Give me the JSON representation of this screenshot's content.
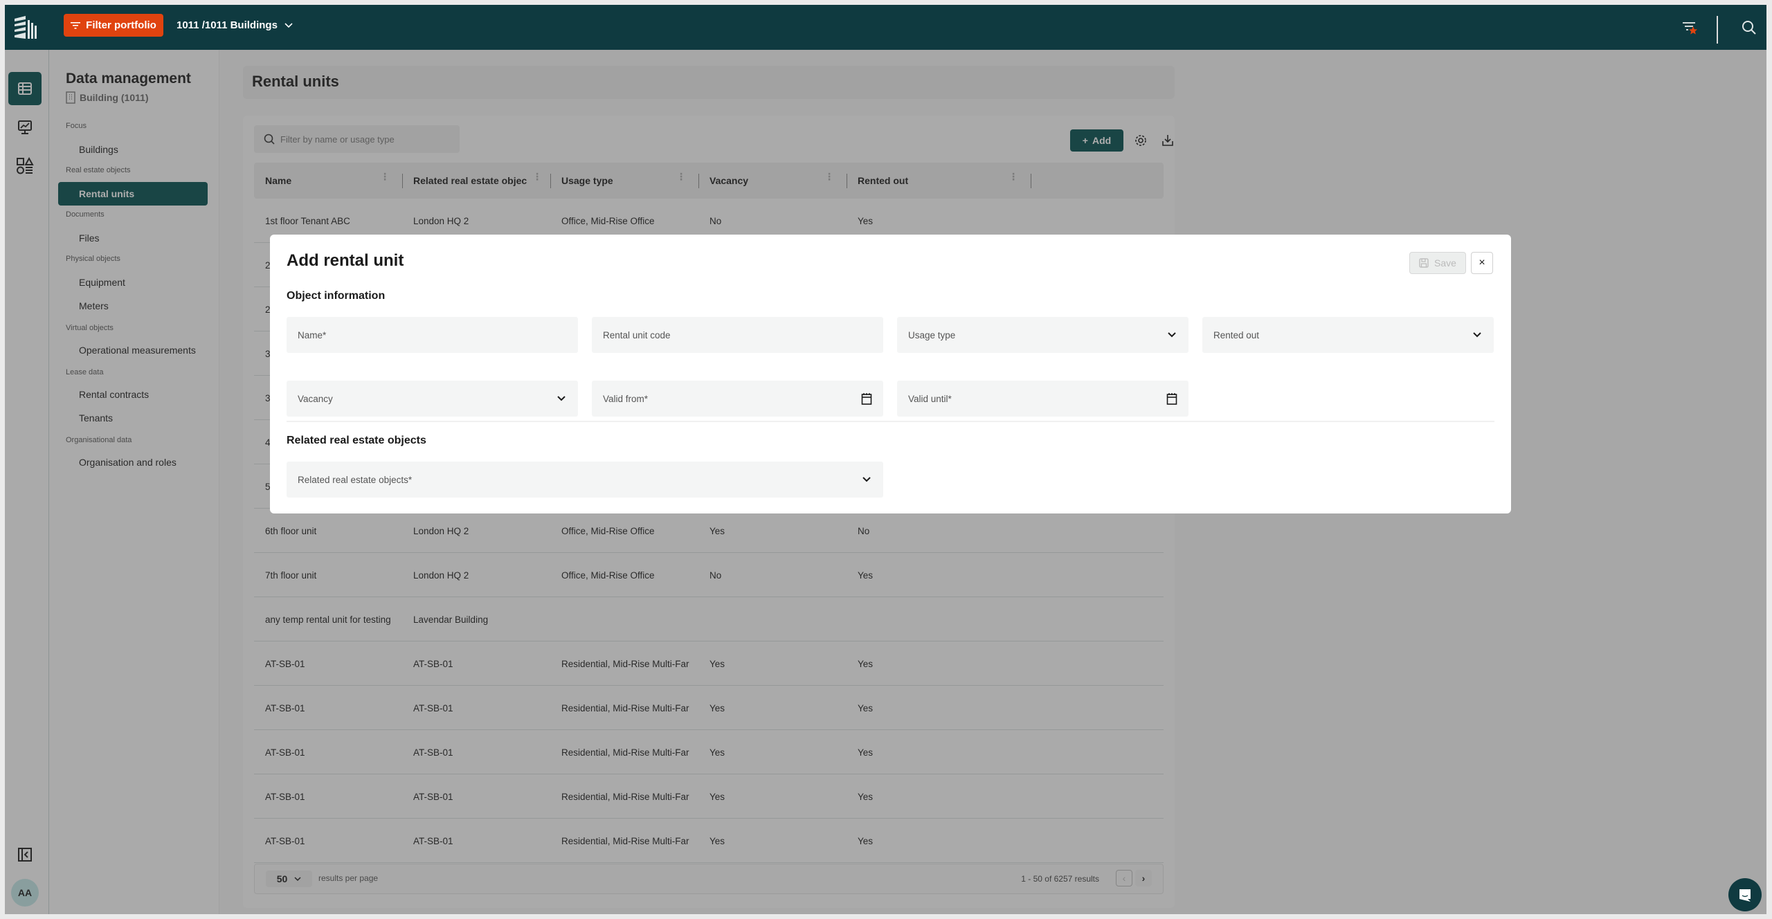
{
  "topbar": {
    "filter_button": "Filter portfolio",
    "portfolio_selector": "1011 /1011 Buildings",
    "icons": [
      "logo-icon",
      "filter-icon",
      "chevron-down-icon",
      "favorite-filter-icon",
      "search-icon"
    ]
  },
  "rail": {
    "items": [
      {
        "name": "data-management",
        "icon": "table-icon",
        "active": true
      },
      {
        "name": "dashboards",
        "icon": "monitor-chart-icon",
        "active": false
      },
      {
        "name": "apps",
        "icon": "shapes-icon",
        "active": false
      }
    ],
    "collapse_icon": "collapse-sidebar-icon",
    "avatar_initials": "AA"
  },
  "sidenav": {
    "title": "Data management",
    "building": "Building (1011)",
    "sections": [
      {
        "label": "Focus",
        "items": [
          {
            "label": "Buildings",
            "active": false
          }
        ]
      },
      {
        "label": "Real estate objects",
        "items": [
          {
            "label": "Rental units",
            "active": true
          }
        ]
      },
      {
        "label": "Documents",
        "items": [
          {
            "label": "Files",
            "active": false
          }
        ]
      },
      {
        "label": "Physical objects",
        "items": [
          {
            "label": "Equipment",
            "active": false
          },
          {
            "label": "Meters",
            "active": false
          }
        ]
      },
      {
        "label": "Virtual objects",
        "items": [
          {
            "label": "Operational measurements",
            "active": false
          }
        ]
      },
      {
        "label": "Lease data",
        "items": [
          {
            "label": "Rental contracts",
            "active": false
          },
          {
            "label": "Tenants",
            "active": false
          }
        ]
      },
      {
        "label": "Organisational data",
        "items": [
          {
            "label": "Organisation and roles",
            "active": false
          }
        ]
      }
    ]
  },
  "main": {
    "page_title": "Rental units",
    "filter_placeholder": "Filter by name or usage type",
    "add_button": "Add",
    "columns": [
      "Name",
      "Related real estate objec",
      "Usage type",
      "Vacancy",
      "Rented out"
    ],
    "rows": [
      [
        "1st floor Tenant ABC",
        "London HQ 2",
        "Office, Mid-Rise Office",
        "No",
        "Yes"
      ],
      [
        "2",
        "",
        "",
        "",
        ""
      ],
      [
        "2",
        "",
        "",
        "",
        ""
      ],
      [
        "3",
        "",
        "",
        "",
        ""
      ],
      [
        "3",
        "",
        "",
        "",
        ""
      ],
      [
        "4",
        "",
        "",
        "",
        ""
      ],
      [
        "5",
        "",
        "",
        "",
        ""
      ],
      [
        "6th floor unit",
        "London HQ 2",
        "Office, Mid-Rise Office",
        "Yes",
        "No"
      ],
      [
        "7th floor unit",
        "London HQ 2",
        "Office, Mid-Rise Office",
        "No",
        "Yes"
      ],
      [
        "any temp rental unit for testing",
        "Lavendar Building",
        "",
        "",
        ""
      ],
      [
        "AT-SB-01",
        "AT-SB-01",
        "Residential, Mid-Rise Multi-Far",
        "Yes",
        "Yes"
      ],
      [
        "AT-SB-01",
        "AT-SB-01",
        "Residential, Mid-Rise Multi-Far",
        "Yes",
        "Yes"
      ],
      [
        "AT-SB-01",
        "AT-SB-01",
        "Residential, Mid-Rise Multi-Far",
        "Yes",
        "Yes"
      ],
      [
        "AT-SB-01",
        "AT-SB-01",
        "Residential, Mid-Rise Multi-Far",
        "Yes",
        "Yes"
      ],
      [
        "AT-SB-01",
        "AT-SB-01",
        "Residential, Mid-Rise Multi-Far",
        "Yes",
        "Yes"
      ]
    ],
    "pagination": {
      "page_size": "50",
      "page_size_label": "results per page",
      "range": "1 -  50 of  6257 results"
    }
  },
  "modal": {
    "title": "Add rental unit",
    "save_button": "Save",
    "close_label": "×",
    "section_object_info": "Object information",
    "fields": {
      "name": "Name*",
      "rental_unit_code": "Rental unit code",
      "usage_type": "Usage type",
      "rented_out": "Rented out",
      "vacancy": "Vacancy",
      "valid_from": "Valid from*",
      "valid_until": "Valid until*"
    },
    "section_related": "Related real estate objects",
    "related_field": "Related real estate objects*"
  },
  "colors": {
    "topbar": "#0f3a40",
    "accent_orange": "#e0430f",
    "primary_teal": "#004d4d"
  }
}
